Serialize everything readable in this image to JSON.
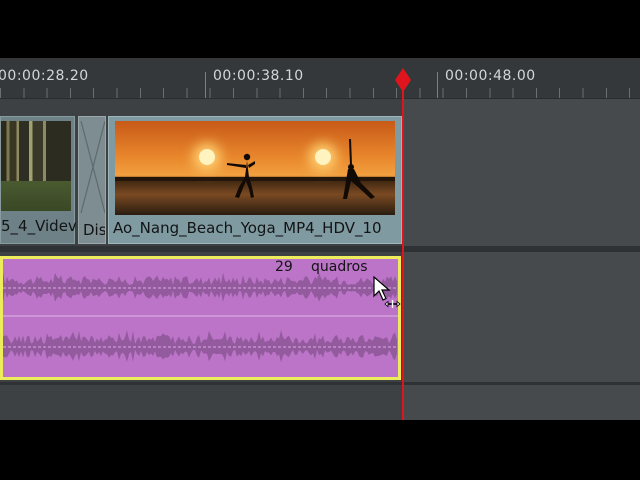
{
  "ruler": {
    "labels": [
      "00:00:28.20",
      "00:00:38.10",
      "00:00:48.00"
    ]
  },
  "video_track": {
    "clip_left_label": "5_4_Videv",
    "transition_label": "Dis",
    "clip_main_label": "Ao_Nang_Beach_Yoga_MP4_HDV_10"
  },
  "audio_track": {
    "frame_count": "29",
    "frame_unit": "quadros"
  },
  "colors": {
    "playhead": "#e0141c",
    "audio_clip": "#bb74c7",
    "audio_selection": "#ecec5c",
    "video_clip": "#7f9aa0"
  },
  "icons": [
    "playhead-diamond-icon",
    "mouse-pointer-icon",
    "trim-cursor-icon"
  ]
}
